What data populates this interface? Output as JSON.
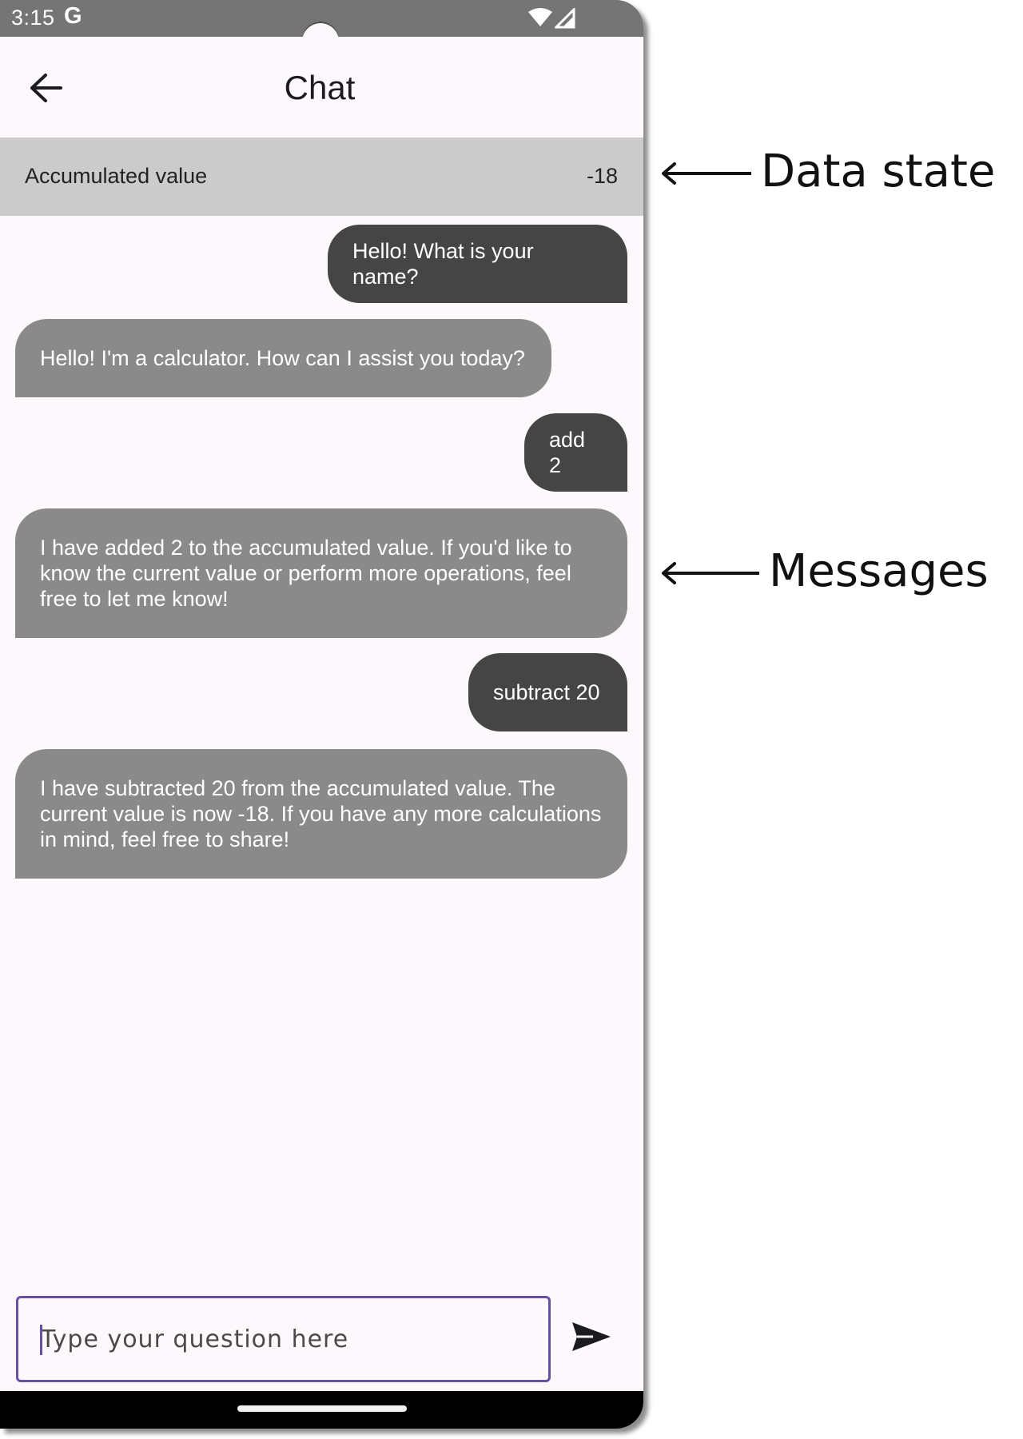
{
  "status_bar": {
    "time": "3:15",
    "g_logo": "G",
    "wifi_icon": "wifi-icon",
    "signal_icon": "signal-icon"
  },
  "app_bar": {
    "title": "Chat",
    "back_icon": "arrow-back-icon"
  },
  "data_state": {
    "label": "Accumulated value",
    "value": "-18"
  },
  "messages": [
    {
      "role": "user",
      "text": "Hello! What is your name?"
    },
    {
      "role": "assistant",
      "text": "Hello! I'm a calculator. How can I assist you today?"
    },
    {
      "role": "user",
      "text": "add 2"
    },
    {
      "role": "assistant",
      "text": "I have added 2 to the accumulated value. If you'd like to know the current value or perform more operations, feel free to let me know!"
    },
    {
      "role": "user",
      "text": "subtract 20"
    },
    {
      "role": "assistant",
      "text": "I have subtracted 20 from the accumulated value. The current value is now -18. If you have any more calculations in mind, feel free to share!"
    }
  ],
  "composer": {
    "placeholder": "Type your question here",
    "value": "",
    "send_icon": "send-icon"
  },
  "annotations": {
    "data_state": "Data state",
    "messages": "Messages"
  },
  "colors": {
    "user_bubble": "#454545",
    "assistant_bubble": "#8a8a8a",
    "data_strip": "#cbcbcb",
    "accent": "#6750a4",
    "background": "#fdf8fc"
  }
}
